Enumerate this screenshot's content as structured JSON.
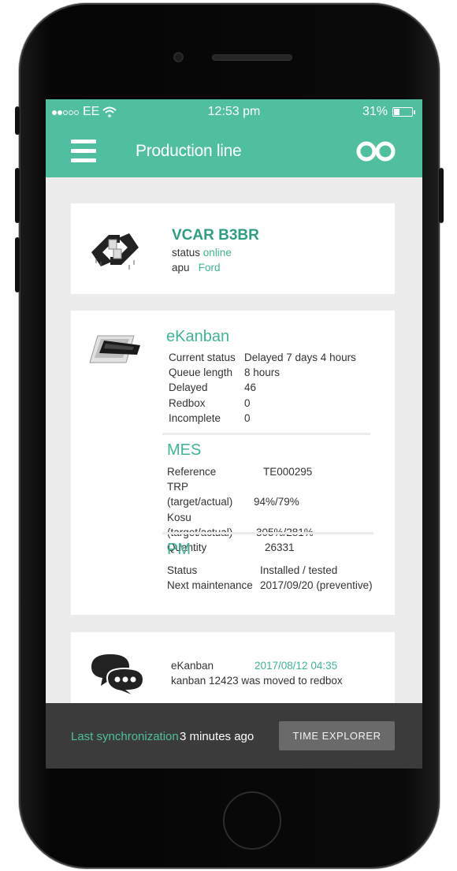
{
  "status_bar": {
    "carrier": "EE",
    "time": "12:53 pm",
    "battery_percent": "31%",
    "battery_level": 0.31
  },
  "app_bar": {
    "title": "Production line",
    "menu_icon": "hamburger-menu-icon",
    "action_icon": "infinity-icon"
  },
  "device_card": {
    "name": "VCAR B3BR",
    "status_label": "status",
    "status_value": "online",
    "apu_label": "apu",
    "apu_value": "Ford",
    "icon": "device-module-icon"
  },
  "ekanban": {
    "title": "eKanban",
    "icon": "ekanban-icon",
    "rows": [
      {
        "label": "Current status",
        "value": "Delayed 7 days 4 hours"
      },
      {
        "label": "Queue length",
        "value": "8 hours"
      },
      {
        "label": "Delayed",
        "value": "46"
      },
      {
        "label": "Redbox",
        "value": "0"
      },
      {
        "label": "Incomplete",
        "value": "0"
      }
    ]
  },
  "mes": {
    "title": "MES",
    "rows": [
      {
        "label": "Reference",
        "value": "TE000295"
      },
      {
        "label": "TRP (target/actual)",
        "value": "94%/79%"
      },
      {
        "label": "Kosu (target/actual)",
        "value": "305%/281%"
      },
      {
        "label": "Quantity",
        "value": "26331"
      }
    ]
  },
  "pm": {
    "title": "PM",
    "rows": [
      {
        "label": "Status",
        "value": "Installed / tested"
      },
      {
        "label": "Next maintenance",
        "value": "2017/09/20 (preventive)"
      }
    ]
  },
  "message": {
    "icon": "chat-bubbles-icon",
    "source": "eKanban",
    "timestamp": "2017/08/12 04:35",
    "text": "kanban 12423 was moved to redbox"
  },
  "bottom_bar": {
    "sync_label": "Last synchronization",
    "sync_value": "3 minutes ago",
    "button_label": "TIME EXPLORER"
  },
  "colors": {
    "accent": "#4fbf9f",
    "bottom_bar": "#3b3b3b",
    "button": "#6a6a6a"
  }
}
